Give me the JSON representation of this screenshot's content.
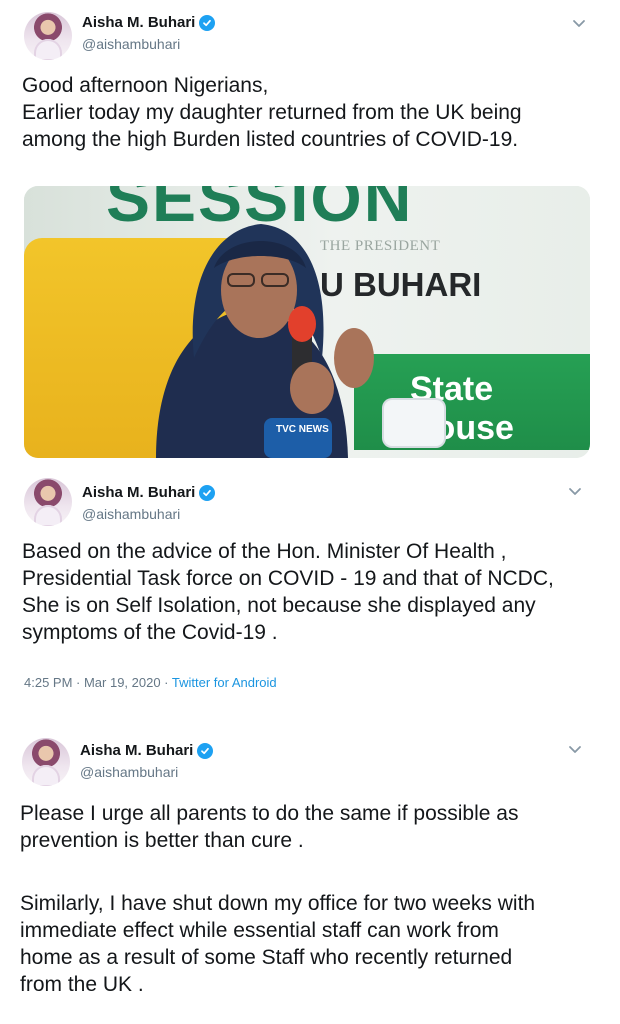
{
  "tweets": [
    {
      "author": "Aisha M. Buhari",
      "handle": "@aishambuhari",
      "lines": [
        "Good afternoon Nigerians,",
        "Earlier today my daughter returned from the UK being",
        "among the high Burden listed countries of COVID-19."
      ],
      "media": {
        "sign_top": "SESSION",
        "sign_sub": "THE PRESIDENT",
        "sign_name": "U BUHARI",
        "sign_green": "State House",
        "mic_label": "TVC NEWS"
      }
    },
    {
      "author": "Aisha M. Buhari",
      "handle": "@aishambuhari",
      "lines": [
        "Based on the advice of the Hon. Minister Of Health ,",
        "Presidential Task force on COVID - 19 and that of NCDC,",
        "She is on Self Isolation, not because she displayed any",
        "symptoms of the Covid-19 ."
      ],
      "timestamp": "4:25 PM · Mar 19, 2020 · ",
      "source": "Twitter for Android"
    },
    {
      "author": "Aisha M. Buhari",
      "handle": "@aishambuhari",
      "lines": [
        "Please I urge all parents to do the same if possible as",
        "prevention is better than cure ."
      ],
      "lines2": [
        "Similarly, I have shut down my office for two weeks with",
        "immediate effect while essential staff can work from",
        "home as a result of some Staff who recently returned",
        "from the UK ."
      ]
    }
  ],
  "colors": {
    "text": "#14171a",
    "secondary": "#657786",
    "verified": "#1da1f2",
    "link": "#1b95e0"
  },
  "icons": [
    "verified-badge-icon",
    "chevron-down-icon"
  ]
}
